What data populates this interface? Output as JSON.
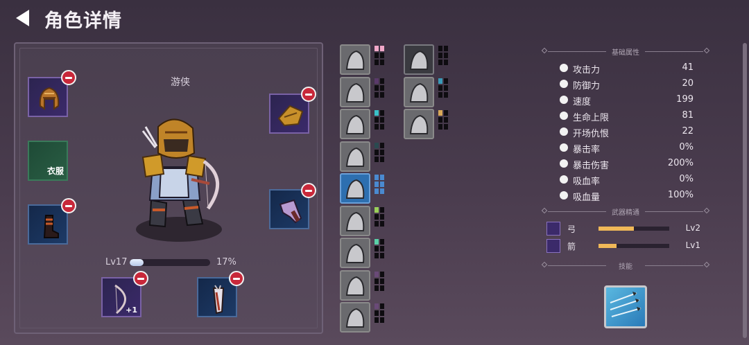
{
  "header": {
    "title": "角色详情"
  },
  "character": {
    "name": "游侠",
    "level_label": "Lv17",
    "xp_percent_label": "17%",
    "xp_fraction": 0.17,
    "armor_slot_label": "衣服",
    "weapon_bonus": "+1"
  },
  "skills_grid": [
    {
      "icon": "boot-icon",
      "pips": [
        "#f0a8c8",
        "#f0a8c8",
        "#0e0c10",
        "#0e0c10",
        "#0e0c10",
        "#0e0c10"
      ]
    },
    {
      "icon": "mist-icon",
      "pips": [
        "#5a3a6a",
        "#0e0c10",
        "#0e0c10",
        "#0e0c10",
        "#0e0c10",
        "#0e0c10"
      ]
    },
    {
      "icon": "leap-icon",
      "pips": [
        "#3ac0c8",
        "#0e0c10",
        "#0e0c10",
        "#0e0c10",
        "#0e0c10",
        "#0e0c10"
      ]
    },
    {
      "icon": "arrows-icon",
      "pips": [
        "#2a4a50",
        "#0e0c10",
        "#0e0c10",
        "#0e0c10",
        "#0e0c10",
        "#0e0c10"
      ]
    },
    {
      "icon": "knight-icon",
      "pips": [
        "#4a8ad0",
        "#4a8ad0",
        "#4a8ad0",
        "#4a8ad0",
        "#4a8ad0",
        "#4a8ad0"
      ]
    },
    {
      "icon": "hood-icon",
      "pips": [
        "#9ad05a",
        "#0e0c10",
        "#0e0c10",
        "#0e0c10",
        "#0e0c10",
        "#0e0c10"
      ]
    },
    {
      "icon": "mask-icon",
      "pips": [
        "#5ad0a8",
        "#0e0c10",
        "#0e0c10",
        "#0e0c10",
        "#0e0c10",
        "#0e0c10"
      ]
    },
    {
      "icon": "rune-icon",
      "pips": [
        "#6a4a78",
        "#0e0c10",
        "#0e0c10",
        "#0e0c10",
        "#0e0c10",
        "#0e0c10"
      ]
    },
    {
      "icon": "hand-icon",
      "pips": [
        "#6a4a78",
        "#0e0c10",
        "#0e0c10",
        "#0e0c10",
        "#0e0c10",
        "#0e0c10"
      ]
    },
    {
      "icon": "orb-icon",
      "pips": [
        "#0e0c10",
        "#0e0c10",
        "#0e0c10",
        "#0e0c10",
        "#0e0c10",
        "#0e0c10"
      ]
    },
    {
      "icon": "helmet-icon",
      "pips": [
        "#3a9ab8",
        "#0e0c10",
        "#0e0c10",
        "#0e0c10",
        "#0e0c10",
        "#0e0c10"
      ]
    },
    {
      "icon": "claw-icon",
      "pips": [
        "#d8a858",
        "#0e0c10",
        "#0e0c10",
        "#0e0c10",
        "#0e0c10",
        "#0e0c10"
      ]
    }
  ],
  "stats": {
    "section_title": "基础属性",
    "items": [
      {
        "icon": "sword-icon",
        "label": "攻击力",
        "value": "41"
      },
      {
        "icon": "shield-icon",
        "label": "防御力",
        "value": "20"
      },
      {
        "icon": "wing-icon",
        "label": "速度",
        "value": "199"
      },
      {
        "icon": "heart-icon",
        "label": "生命上限",
        "value": "81"
      },
      {
        "icon": "skull-icon",
        "label": "开场仇恨",
        "value": "22"
      },
      {
        "icon": "crit-icon",
        "label": "暴击率",
        "value": "0%"
      },
      {
        "icon": "crossed-swords-icon",
        "label": "暴击伤害",
        "value": "200%"
      },
      {
        "icon": "fang-icon",
        "label": "吸血率",
        "value": "0%"
      },
      {
        "icon": "jaw-icon",
        "label": "吸血量",
        "value": "100%"
      }
    ]
  },
  "weapon_mastery": {
    "section_title": "武器精通",
    "items": [
      {
        "icon": "bow-icon",
        "label": "弓",
        "level": "Lv2",
        "progress": 0.5
      },
      {
        "icon": "arrow-icon",
        "label": "箭",
        "level": "Lv1",
        "progress": 0.25
      }
    ]
  },
  "skills": {
    "section_title": "技能",
    "equipped_icon": "volley-icon"
  },
  "colors": {
    "accent_gold": "#f0b858",
    "remove_red": "#c8283a"
  }
}
